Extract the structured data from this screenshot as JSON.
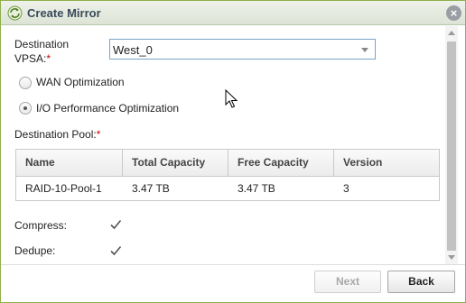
{
  "window": {
    "title": "Create Mirror"
  },
  "form": {
    "destination_vpsa_label": "Destination VPSA:",
    "destination_vpsa_value": "West_0",
    "radio_options": [
      {
        "label": "WAN Optimization",
        "checked": false
      },
      {
        "label": "I/O Performance Optimization",
        "checked": true
      }
    ],
    "destination_pool_label": "Destination Pool:",
    "required_marker": "*",
    "compress_label": "Compress:",
    "compress_checked": true,
    "dedupe_label": "Dedupe:",
    "dedupe_checked": true
  },
  "pool_table": {
    "columns": [
      "Name",
      "Total Capacity",
      "Free Capacity",
      "Version"
    ],
    "rows": [
      [
        "RAID-10-Pool-1",
        "3.47 TB",
        "3.47 TB",
        "3"
      ]
    ]
  },
  "buttons": {
    "next": "Next",
    "back": "Back"
  },
  "colors": {
    "border": "#8fb04a",
    "select_border": "#7aa3c7",
    "required": "#cc0000"
  }
}
